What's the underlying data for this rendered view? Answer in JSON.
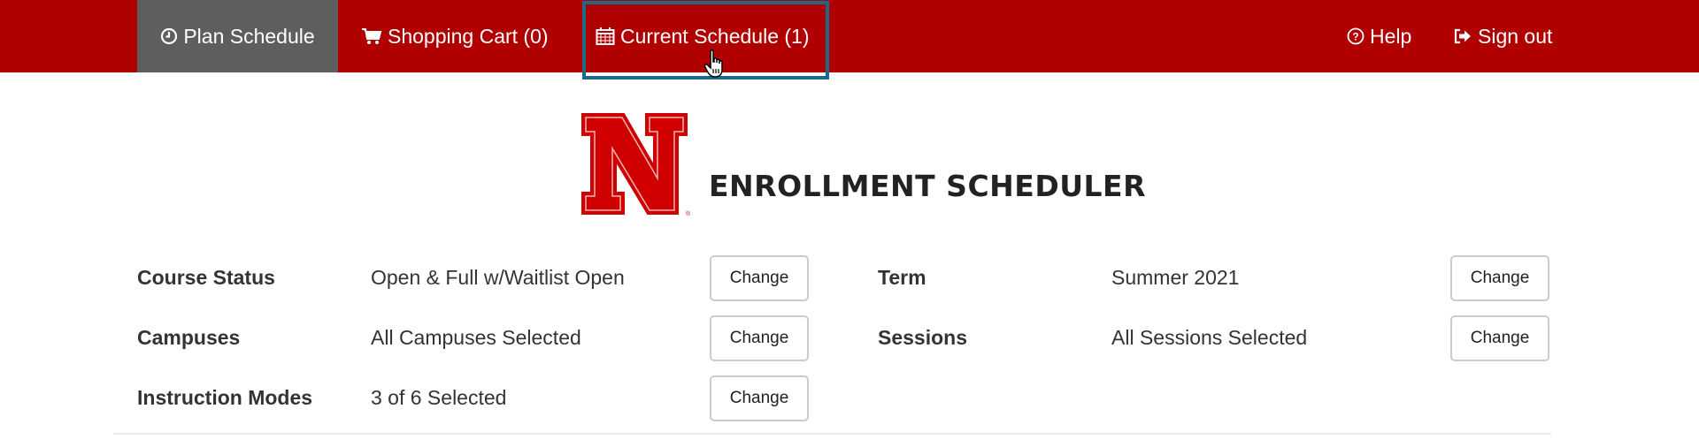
{
  "nav": {
    "plan_schedule": "Plan Schedule",
    "shopping_cart": "Shopping Cart (0)",
    "current_schedule": "Current Schedule (1)",
    "help": "Help",
    "sign_out": "Sign out"
  },
  "colors": {
    "nav_bg": "#b00000",
    "active_tab": "#5e5e5e",
    "focus_outline": "#1b6a8a",
    "logo_red": "#d00000"
  },
  "logo": {
    "letter": "N",
    "title": "ENROLLMENT SCHEDULER"
  },
  "filters": {
    "left": [
      {
        "label": "Course Status",
        "value": "Open & Full w/Waitlist Open",
        "button": "Change"
      },
      {
        "label": "Campuses",
        "value": "All Campuses Selected",
        "button": "Change"
      },
      {
        "label": "Instruction Modes",
        "value": "3 of 6 Selected",
        "button": "Change"
      }
    ],
    "right": [
      {
        "label": "Term",
        "value": "Summer 2021",
        "button": "Change"
      },
      {
        "label": "Sessions",
        "value": "All Sessions Selected",
        "button": "Change"
      }
    ]
  }
}
